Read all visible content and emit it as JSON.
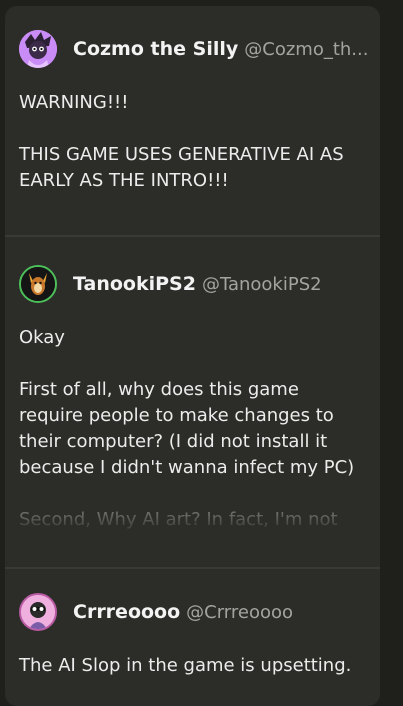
{
  "posts": [
    {
      "author": "Cozmo the Silly",
      "handle": "@Cozmo_th...",
      "paragraphs": [
        "WARNING!!!",
        "THIS GAME USES GENERATIVE AI AS EARLY AS THE INTRO!!!"
      ]
    },
    {
      "author": "TanookiPS2",
      "handle": "@TanookiPS2",
      "paragraphs": [
        "Okay",
        "First of all, why does this game require people to make changes to their computer? (I did not install it because I didn't wanna infect my PC)",
        "Second, Why AI art? In fact, I'm not"
      ]
    },
    {
      "author": "Crrreoooo",
      "handle": "@Crrreoooo",
      "paragraphs": [
        "The AI Slop in the game is upsetting."
      ]
    }
  ],
  "colors": {
    "background": "#1f1f1b",
    "card": "#2c2c28",
    "text": "#ececec",
    "handle": "#a3a3a0"
  },
  "icons": {
    "post1_avatar": "purple-character-avatar",
    "post2_avatar": "tanooki-character-avatar",
    "post3_avatar": "pink-character-avatar"
  }
}
